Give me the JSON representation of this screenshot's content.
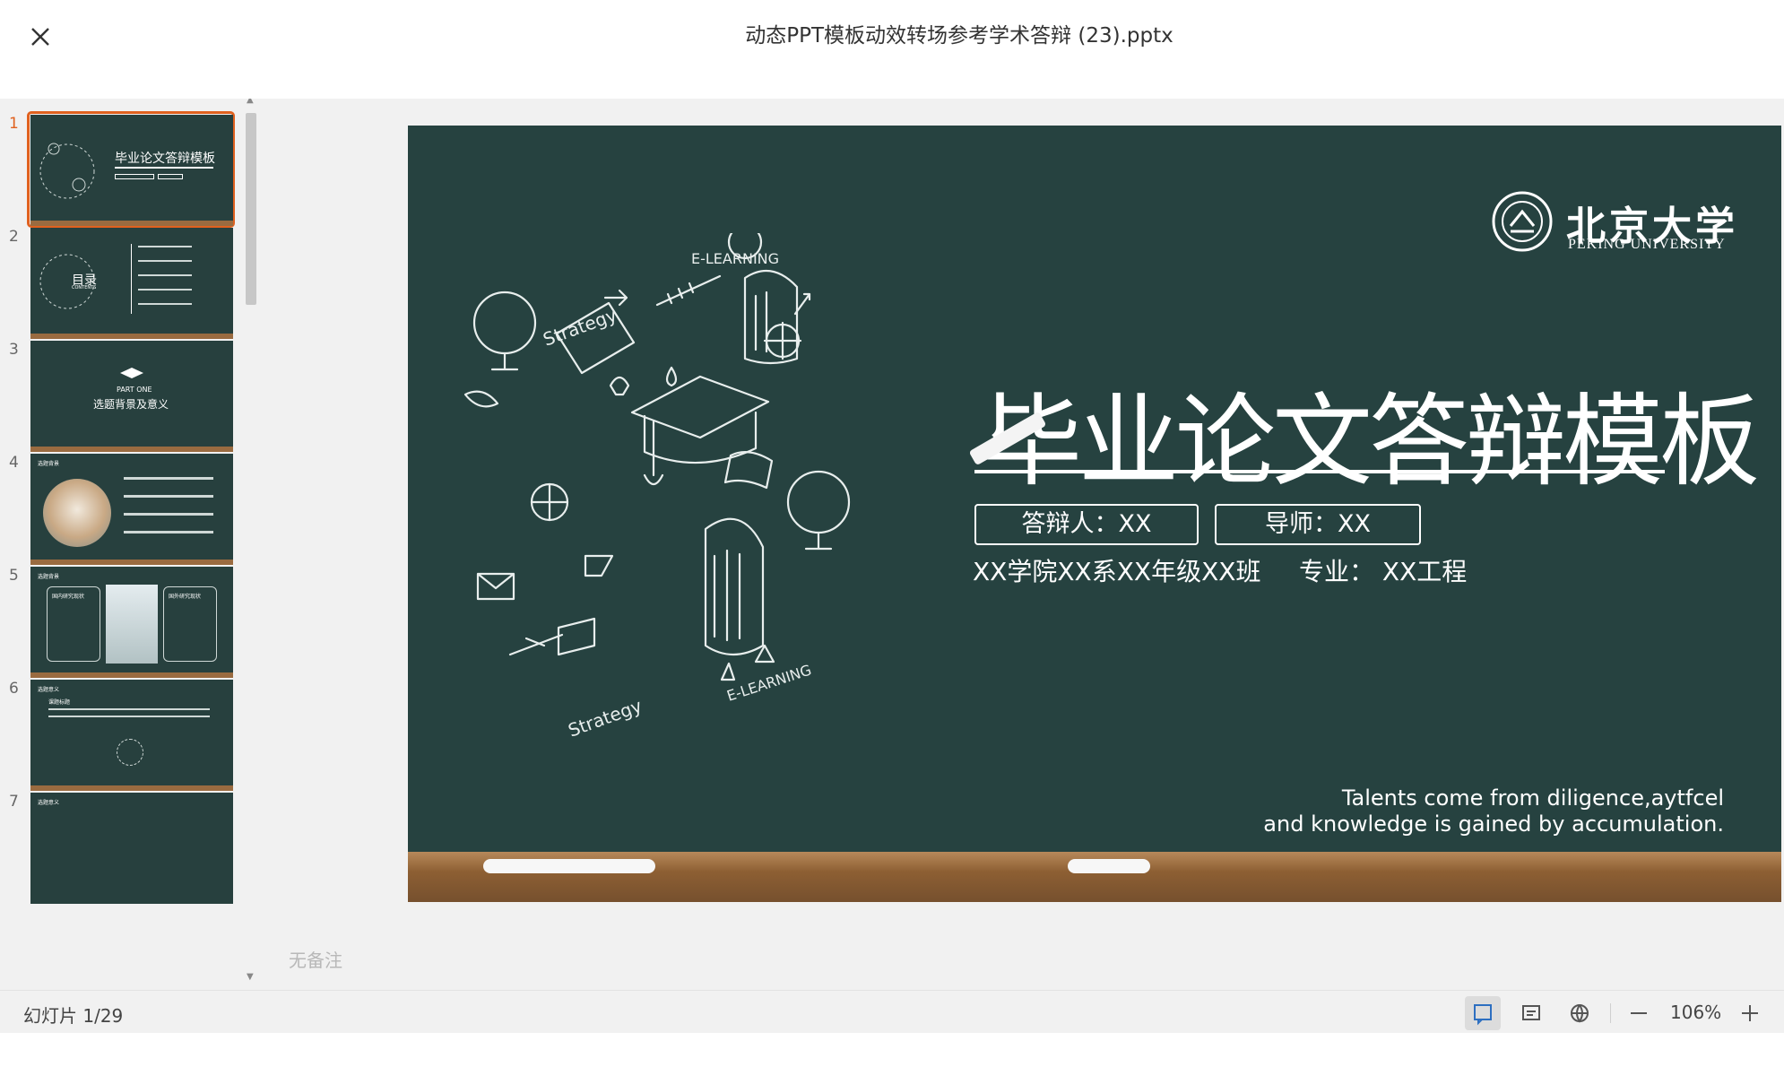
{
  "window": {
    "title": "动态PPT模板动效转场参考学术答辩 (23).pptx",
    "close_icon": "close-icon"
  },
  "thumbnails": [
    {
      "number": "1",
      "active": true,
      "title": "毕业论文答辩模板"
    },
    {
      "number": "2",
      "title": "目录",
      "subtitle": "CONTENTS"
    },
    {
      "number": "3",
      "title": "选题背景及意义",
      "kicker": "PART ONE"
    },
    {
      "number": "4",
      "label": "选题背景"
    },
    {
      "number": "5",
      "label": "选题背景",
      "left_heading": "国内研究现状",
      "right_heading": "国外研究现状"
    },
    {
      "number": "6",
      "label": "选题意义",
      "heading": "课题标题"
    },
    {
      "number": "7",
      "label": "选题意义"
    }
  ],
  "slide": {
    "title": "毕业论文答辩模板",
    "defender_label": "答辩人：XX",
    "advisor_label": "导师：XX",
    "class_info": "XX学院XX系XX年级XX班",
    "major_info": "专业：  XX工程",
    "quote_line1": "Talents come from diligence,aytfcel",
    "quote_line2": "and knowledge is gained by accumulation.",
    "logo_cn": "北京大学",
    "logo_en": "PEKING UNIVERSITY",
    "doodle_labels": [
      "E-LEARNING",
      "Strategy",
      "Strategy",
      "E-LEARNING"
    ],
    "colors": {
      "board": "#264240",
      "ledge": "#8d5f33",
      "chalk": "#f7f7f7",
      "accent": "#e0611f"
    }
  },
  "notes": {
    "placeholder": "无备注"
  },
  "statusbar": {
    "slide_counter": "幻灯片 1/29",
    "zoom": "106%",
    "icons": [
      "notes-view-icon",
      "subtitle-icon",
      "globe-icon",
      "zoom-out-icon",
      "zoom-in-icon"
    ]
  }
}
